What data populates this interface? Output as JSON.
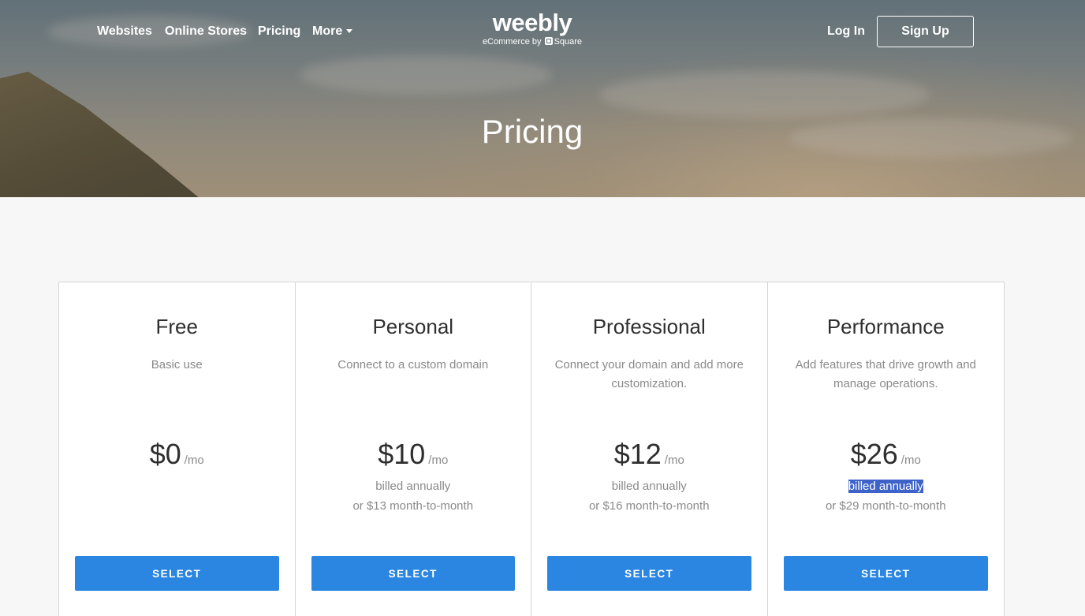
{
  "nav": {
    "links": [
      "Websites",
      "Online Stores",
      "Pricing"
    ],
    "more_label": "More",
    "login_label": "Log In",
    "signup_label": "Sign Up"
  },
  "logo": {
    "wordmark": "weebly",
    "tagline_prefix": "eCommerce by",
    "tagline_brand": "Square"
  },
  "hero": {
    "title": "Pricing"
  },
  "plans": [
    {
      "name": "Free",
      "description": "Basic use",
      "price": "$0",
      "period": "/mo",
      "billing": "",
      "monthly": "",
      "button": "SELECT"
    },
    {
      "name": "Personal",
      "description": "Connect to a custom domain",
      "price": "$10",
      "period": "/mo",
      "billing": "billed annually",
      "monthly": "or $13 month-to-month",
      "button": "SELECT"
    },
    {
      "name": "Professional",
      "description": "Connect your domain and add more customization.",
      "price": "$12",
      "period": "/mo",
      "billing": "billed annually",
      "monthly": "or $16 month-to-month",
      "button": "SELECT"
    },
    {
      "name": "Performance",
      "description": "Add features that drive growth and manage operations.",
      "price": "$26",
      "period": "/mo",
      "billing": "billed annually",
      "monthly": "or $29 month-to-month",
      "button": "SELECT"
    }
  ],
  "colors": {
    "accent": "#2a86e0",
    "selection_highlight": "#3d63c8"
  }
}
